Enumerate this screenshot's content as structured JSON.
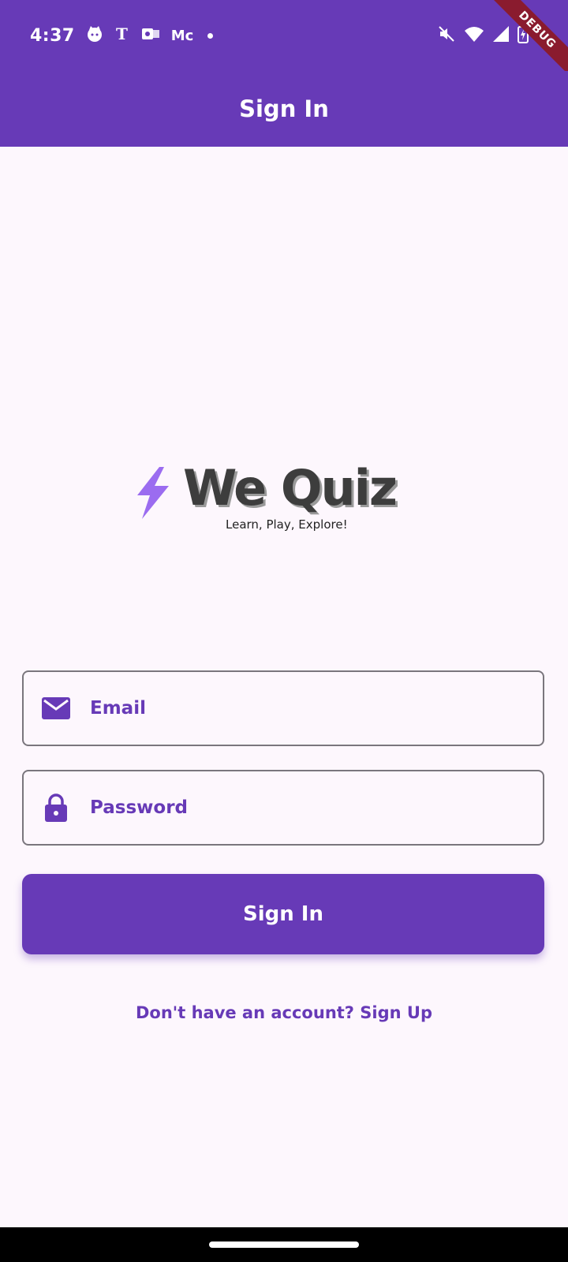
{
  "status_bar": {
    "time": "4:37",
    "notification_text": "Mc",
    "icons": [
      "cat-icon",
      "nyt-icon",
      "outlook-icon",
      "mute-icon",
      "wifi-icon",
      "signal-icon",
      "battery-icon"
    ]
  },
  "debug_banner": {
    "label": "DEBUG"
  },
  "app_bar": {
    "title": "Sign In"
  },
  "logo": {
    "title": "We Quiz",
    "tagline": "Learn, Play, Explore!"
  },
  "form": {
    "email": {
      "placeholder": "Email",
      "value": ""
    },
    "password": {
      "placeholder": "Password",
      "value": ""
    }
  },
  "actions": {
    "sign_in_label": "Sign In",
    "sign_up_link": "Don't have an account? Sign Up"
  },
  "colors": {
    "primary": "#673ab7",
    "background": "#fdf7fd",
    "bolt": "#9b6cf0"
  }
}
